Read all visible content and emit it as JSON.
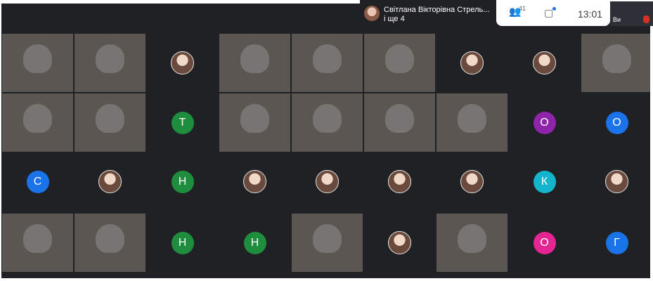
{
  "header": {
    "speaker_name": "Світлана Вікторівна Стрель...",
    "speaker_more": "і ще 4",
    "participants_count": "41",
    "time": "13:01",
    "self_label": "Ви"
  },
  "colors": {
    "meeting_bg": "#202124",
    "green": "#1e8e3e",
    "blue": "#1a73e8",
    "purple": "#8e24aa",
    "teal": "#12b5cb",
    "pink": "#e52592"
  },
  "tiles": [
    {
      "type": "video"
    },
    {
      "type": "video"
    },
    {
      "type": "photo"
    },
    {
      "type": "video"
    },
    {
      "type": "video"
    },
    {
      "type": "video"
    },
    {
      "type": "photo"
    },
    {
      "type": "photo"
    },
    {
      "type": "video"
    },
    {
      "type": "video"
    },
    {
      "type": "video"
    },
    {
      "type": "letter",
      "label": "Т",
      "color": "green"
    },
    {
      "type": "video"
    },
    {
      "type": "video"
    },
    {
      "type": "video"
    },
    {
      "type": "video"
    },
    {
      "type": "letter",
      "label": "О",
      "color": "purple"
    },
    {
      "type": "letter",
      "label": "О",
      "color": "blue"
    },
    {
      "type": "letter",
      "label": "С",
      "color": "blue"
    },
    {
      "type": "photo"
    },
    {
      "type": "letter",
      "label": "Н",
      "color": "green"
    },
    {
      "type": "photo"
    },
    {
      "type": "photo"
    },
    {
      "type": "photo"
    },
    {
      "type": "photo"
    },
    {
      "type": "letter",
      "label": "К",
      "color": "teal"
    },
    {
      "type": "photo"
    },
    {
      "type": "video"
    },
    {
      "type": "video"
    },
    {
      "type": "letter",
      "label": "Н",
      "color": "green"
    },
    {
      "type": "letter",
      "label": "Н",
      "color": "green"
    },
    {
      "type": "video"
    },
    {
      "type": "photo"
    },
    {
      "type": "video"
    },
    {
      "type": "letter",
      "label": "О",
      "color": "pink"
    },
    {
      "type": "letter",
      "label": "Г",
      "color": "blue"
    }
  ]
}
